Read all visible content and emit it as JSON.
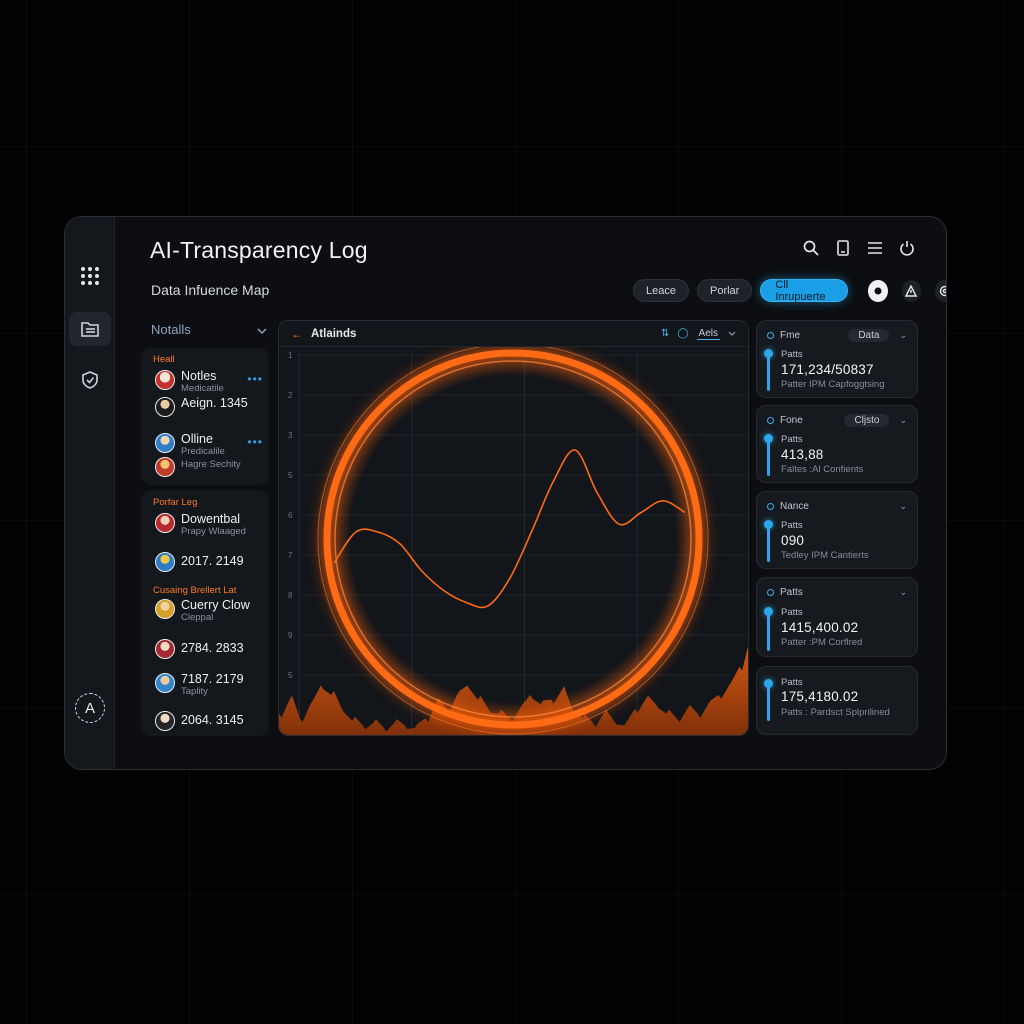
{
  "app": {
    "title": "AI-Transparency Log",
    "subtitle": "Data Infuence Map"
  },
  "filters": {
    "pills": [
      "Leace",
      "Porlar",
      "Cll Inrupuerte"
    ]
  },
  "left_panel": {
    "header": "Notalls",
    "groups": [
      {
        "label": "Heall",
        "entries": [
          {
            "title": "Notles",
            "sub": "Medicatile"
          },
          {
            "title": "Aeign. 1345",
            "sub": ""
          },
          {
            "title": "Olline",
            "sub": "Predicalile"
          },
          {
            "title": "",
            "sub": "Hagre Sechity"
          }
        ]
      },
      {
        "label": "Porfar Leg",
        "entries": [
          {
            "title": "Dowentbal",
            "sub": "Prapy Wlaaged"
          },
          {
            "title": "2017. 2149",
            "sub": ""
          }
        ]
      },
      {
        "label": "Cusaing Brellert Lat",
        "entries": [
          {
            "title": "Cuerry Clow",
            "sub": "Cleppal"
          },
          {
            "title": "2784. 2833",
            "sub": ""
          },
          {
            "title": "7187. 2179",
            "sub": "Taplity"
          },
          {
            "title": "2064. 3145",
            "sub": ""
          }
        ]
      }
    ]
  },
  "chart": {
    "title": "Atlainds",
    "axis_select": "Aels",
    "y_ticks": [
      "1",
      "2",
      "3",
      "5",
      "6",
      "7",
      "8",
      "9",
      "5"
    ]
  },
  "chart_data": {
    "type": "area",
    "title": "Atlainds",
    "y_tick_labels": [
      "1",
      "2",
      "3",
      "5",
      "6",
      "7",
      "8",
      "9",
      "5"
    ],
    "line": [
      0.42,
      0.5,
      0.5,
      0.47,
      0.4,
      0.35,
      0.32,
      0.31,
      0.38,
      0.5,
      0.63,
      0.71,
      0.6,
      0.52,
      0.55,
      0.58,
      0.55
    ],
    "area": [
      0.1,
      0.16,
      0.08,
      0.14,
      0.22,
      0.18,
      0.12,
      0.07,
      0.05,
      0.06,
      0.04,
      0.06,
      0.05,
      0.04,
      0.08,
      0.15,
      0.12,
      0.18,
      0.22,
      0.16,
      0.12,
      0.1,
      0.08,
      0.12,
      0.18,
      0.14,
      0.16,
      0.2,
      0.12,
      0.08,
      0.06,
      0.1,
      0.07,
      0.05,
      0.12,
      0.16,
      0.14,
      0.1,
      0.08,
      0.12,
      0.1,
      0.14,
      0.18,
      0.22,
      0.3,
      0.42
    ],
    "series_colors": {
      "line": "#ff6a14",
      "area": "#ff6a14"
    }
  },
  "stats": [
    {
      "head": "Fme",
      "select": "Data",
      "label": "Patts",
      "value": "171,234/50837",
      "note": "Patter IPM Capfoggtsing"
    },
    {
      "head": "Fone",
      "select": "Cljsto",
      "label": "Patts",
      "value": "413,88",
      "note": "Faltes :Al Confients"
    },
    {
      "head": "Nance",
      "select": "",
      "label": "Patts",
      "value": "090",
      "note": "Tedley IPM Cantierts"
    },
    {
      "head": "Patts",
      "select": "",
      "label": "Patts",
      "value": "1415,400.02",
      "note": "Patter :PM Corflred"
    },
    {
      "head": "",
      "select": "",
      "label": "Patts",
      "value": "175,4180.02",
      "note": "Patts : Pardsct Splprilined"
    }
  ],
  "rail": {
    "avatar_letter": "A"
  },
  "colors": {
    "accent_orange": "#ff6a14",
    "accent_blue": "#1a9fe6"
  }
}
